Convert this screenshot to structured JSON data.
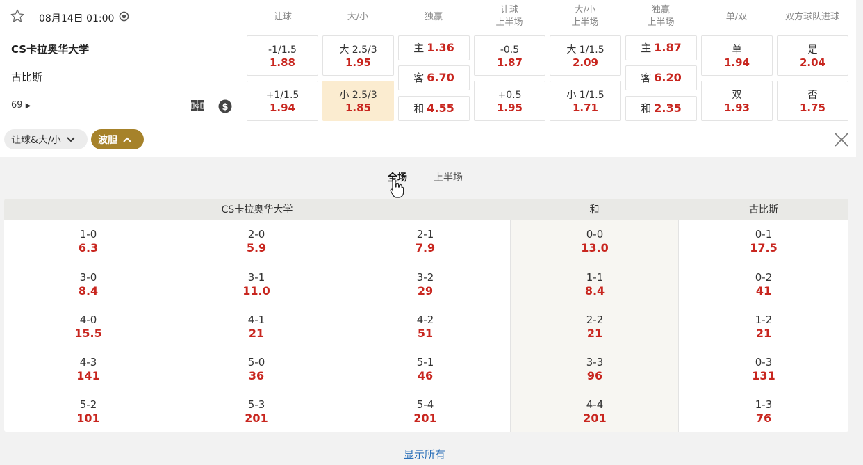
{
  "match": {
    "datetime": "08月14日 01:00",
    "home": "CS卡拉奥华大学",
    "away": "古比斯",
    "more_count": "69"
  },
  "market_headers": [
    {
      "l1": "让球",
      "l2": ""
    },
    {
      "l1": "大/小",
      "l2": ""
    },
    {
      "l1": "独赢",
      "l2": ""
    },
    {
      "l1": "让球",
      "l2": "上半场"
    },
    {
      "l1": "大/小",
      "l2": "上半场"
    },
    {
      "l1": "独赢",
      "l2": "上半场"
    },
    {
      "l1": "单/双",
      "l2": ""
    },
    {
      "l1": "双方球队进球",
      "l2": ""
    }
  ],
  "markets": {
    "handicap": [
      {
        "label": "-1/1.5",
        "odd": "1.88"
      },
      {
        "label": "+1/1.5",
        "odd": "1.94"
      }
    ],
    "over_under": [
      {
        "label": "大 2.5/3",
        "odd": "1.95"
      },
      {
        "label": "小 2.5/3",
        "odd": "1.85"
      }
    ],
    "moneyline": [
      {
        "label": "主",
        "odd": "1.36"
      },
      {
        "label": "客",
        "odd": "6.70"
      },
      {
        "label": "和",
        "odd": "4.55"
      }
    ],
    "handicap_1h": [
      {
        "label": "-0.5",
        "odd": "1.87"
      },
      {
        "label": "+0.5",
        "odd": "1.95"
      }
    ],
    "over_under_1h": [
      {
        "label": "大 1/1.5",
        "odd": "2.09"
      },
      {
        "label": "小 1/1.5",
        "odd": "1.71"
      }
    ],
    "moneyline_1h": [
      {
        "label": "主",
        "odd": "1.87"
      },
      {
        "label": "客",
        "odd": "6.20"
      },
      {
        "label": "和",
        "odd": "2.35"
      }
    ],
    "odd_even": [
      {
        "label": "单",
        "odd": "1.94"
      },
      {
        "label": "双",
        "odd": "1.93"
      }
    ],
    "btts": [
      {
        "label": "是",
        "odd": "2.04"
      },
      {
        "label": "否",
        "odd": "1.75"
      }
    ]
  },
  "filters": {
    "handicap_ou": "让球&大/小",
    "correct_score": "波胆"
  },
  "tabs": {
    "full": "全场",
    "half": "上半场"
  },
  "grid_headers": {
    "home": "CS卡拉奥华大学",
    "draw": "和",
    "away": "古比斯"
  },
  "grid_rows": [
    [
      {
        "s": "1-0",
        "o": "6.3"
      },
      {
        "s": "2-0",
        "o": "5.9"
      },
      {
        "s": "2-1",
        "o": "7.9"
      },
      {
        "s": "0-0",
        "o": "13.0"
      },
      {
        "s": "0-1",
        "o": "17.5"
      }
    ],
    [
      {
        "s": "3-0",
        "o": "8.4"
      },
      {
        "s": "3-1",
        "o": "11.0"
      },
      {
        "s": "3-2",
        "o": "29"
      },
      {
        "s": "1-1",
        "o": "8.4"
      },
      {
        "s": "0-2",
        "o": "41"
      }
    ],
    [
      {
        "s": "4-0",
        "o": "15.5"
      },
      {
        "s": "4-1",
        "o": "21"
      },
      {
        "s": "4-2",
        "o": "51"
      },
      {
        "s": "2-2",
        "o": "21"
      },
      {
        "s": "1-2",
        "o": "21"
      }
    ],
    [
      {
        "s": "4-3",
        "o": "141"
      },
      {
        "s": "5-0",
        "o": "36"
      },
      {
        "s": "5-1",
        "o": "46"
      },
      {
        "s": "3-3",
        "o": "96"
      },
      {
        "s": "0-3",
        "o": "131"
      }
    ],
    [
      {
        "s": "5-2",
        "o": "101"
      },
      {
        "s": "5-3",
        "o": "201"
      },
      {
        "s": "5-4",
        "o": "201"
      },
      {
        "s": "4-4",
        "o": "201"
      },
      {
        "s": "1-3",
        "o": "76"
      }
    ]
  ],
  "show_all": "显示所有",
  "colors": {
    "odds_red": "#c8261f",
    "gold": "#a6822a",
    "selected": "#fbecd0",
    "link": "#2a6fb8"
  }
}
